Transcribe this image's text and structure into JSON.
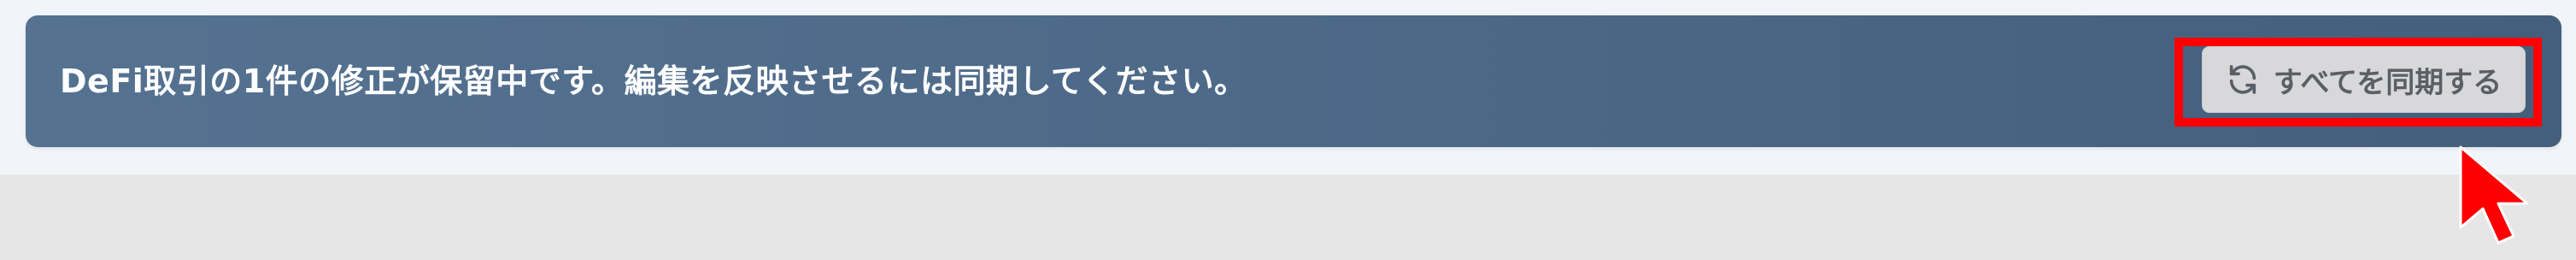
{
  "banner": {
    "message": "DeFi取引の1件の修正が保留中です。編集を反映させるには同期してください。",
    "sync_button_label": "すべてを同期する",
    "sync_button_icon": "refresh-icon"
  },
  "colors": {
    "banner_start": "#557291",
    "banner_end": "#445f7c",
    "button_bg": "#d8d8da",
    "button_text": "#5a5f66",
    "highlight": "#ff0000",
    "cursor": "#ff0000"
  }
}
